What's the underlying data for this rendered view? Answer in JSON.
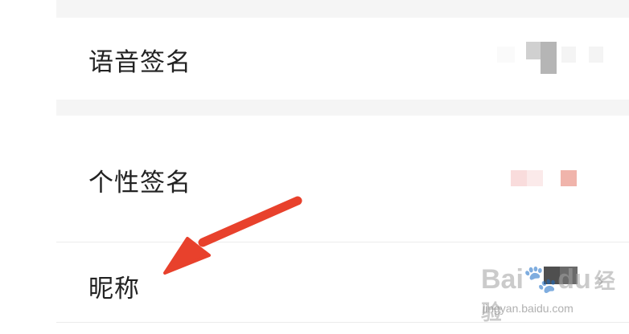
{
  "settings": {
    "rows": [
      {
        "label": "语音签名"
      },
      {
        "label": "个性签名"
      },
      {
        "label": "昵称"
      }
    ],
    "chevron": "›"
  },
  "watermark": {
    "brand_main": "Bai",
    "brand_tail": "du",
    "brand_cn": "经验",
    "url": "jingyan.baidu.com"
  },
  "icons": {
    "row_arrow": "chevron-right-icon",
    "annotation": "red-arrow-annotation-icon"
  },
  "colors": {
    "annotation_arrow": "#e8412c",
    "label_text": "#222222",
    "divider_band": "#f5f5f5"
  }
}
